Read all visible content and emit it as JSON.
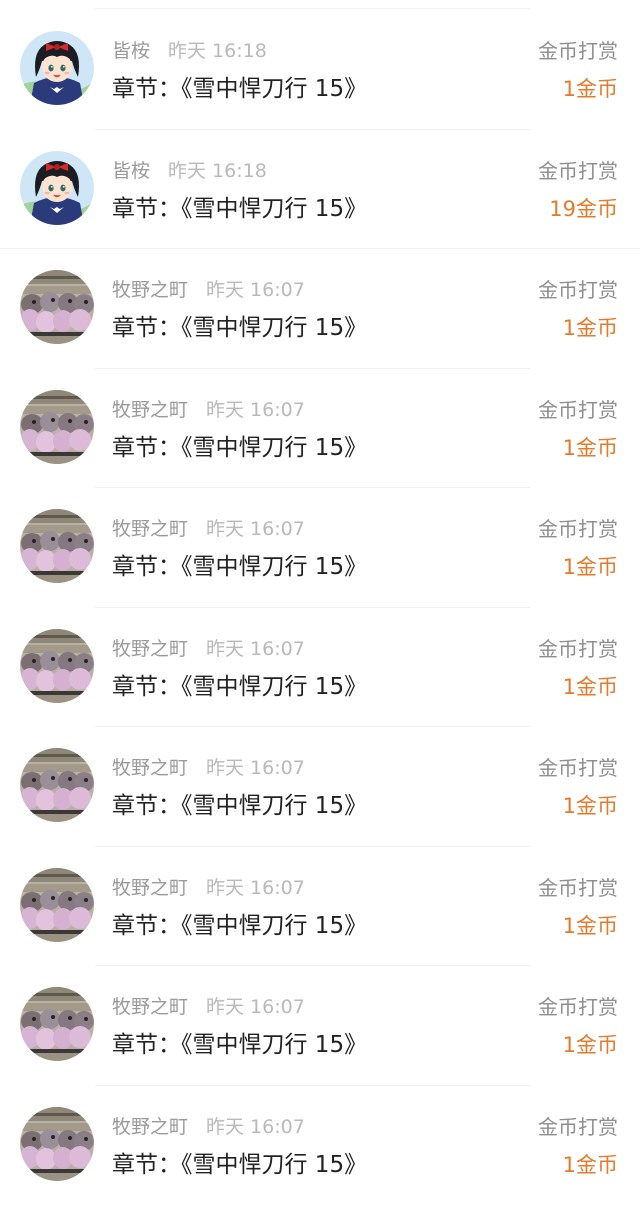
{
  "colors": {
    "background": "#ffffff",
    "name": "#9a9a9a",
    "time": "#b9b9b9",
    "chapter": "#222222",
    "type": "#8e8e8e",
    "amount": "#e57a2b",
    "divider": "#f0f0f0"
  },
  "records": [
    {
      "avatar": "anime-girl-avatar",
      "name": "皆桉",
      "time": "昨天 16:18",
      "chapter": "章节：《雪中悍刀行 15》",
      "type": "金币打赏",
      "amount": "1金币"
    },
    {
      "avatar": "anime-girl-avatar",
      "name": "皆桉",
      "time": "昨天 16:18",
      "chapter": "章节：《雪中悍刀行 15》",
      "type": "金币打赏",
      "amount": "19金币"
    },
    {
      "avatar": "cats-photo-avatar",
      "name": "牧野之町",
      "time": "昨天 16:07",
      "chapter": "章节：《雪中悍刀行 15》",
      "type": "金币打赏",
      "amount": "1金币"
    },
    {
      "avatar": "cats-photo-avatar",
      "name": "牧野之町",
      "time": "昨天 16:07",
      "chapter": "章节：《雪中悍刀行 15》",
      "type": "金币打赏",
      "amount": "1金币"
    },
    {
      "avatar": "cats-photo-avatar",
      "name": "牧野之町",
      "time": "昨天 16:07",
      "chapter": "章节：《雪中悍刀行 15》",
      "type": "金币打赏",
      "amount": "1金币"
    },
    {
      "avatar": "cats-photo-avatar",
      "name": "牧野之町",
      "time": "昨天 16:07",
      "chapter": "章节：《雪中悍刀行 15》",
      "type": "金币打赏",
      "amount": "1金币"
    },
    {
      "avatar": "cats-photo-avatar",
      "name": "牧野之町",
      "time": "昨天 16:07",
      "chapter": "章节：《雪中悍刀行 15》",
      "type": "金币打赏",
      "amount": "1金币"
    },
    {
      "avatar": "cats-photo-avatar",
      "name": "牧野之町",
      "time": "昨天 16:07",
      "chapter": "章节：《雪中悍刀行 15》",
      "type": "金币打赏",
      "amount": "1金币"
    },
    {
      "avatar": "cats-photo-avatar",
      "name": "牧野之町",
      "time": "昨天 16:07",
      "chapter": "章节：《雪中悍刀行 15》",
      "type": "金币打赏",
      "amount": "1金币"
    },
    {
      "avatar": "cats-photo-avatar",
      "name": "牧野之町",
      "time": "昨天 16:07",
      "chapter": "章节：《雪中悍刀行 15》",
      "type": "金币打赏",
      "amount": "1金币"
    }
  ]
}
